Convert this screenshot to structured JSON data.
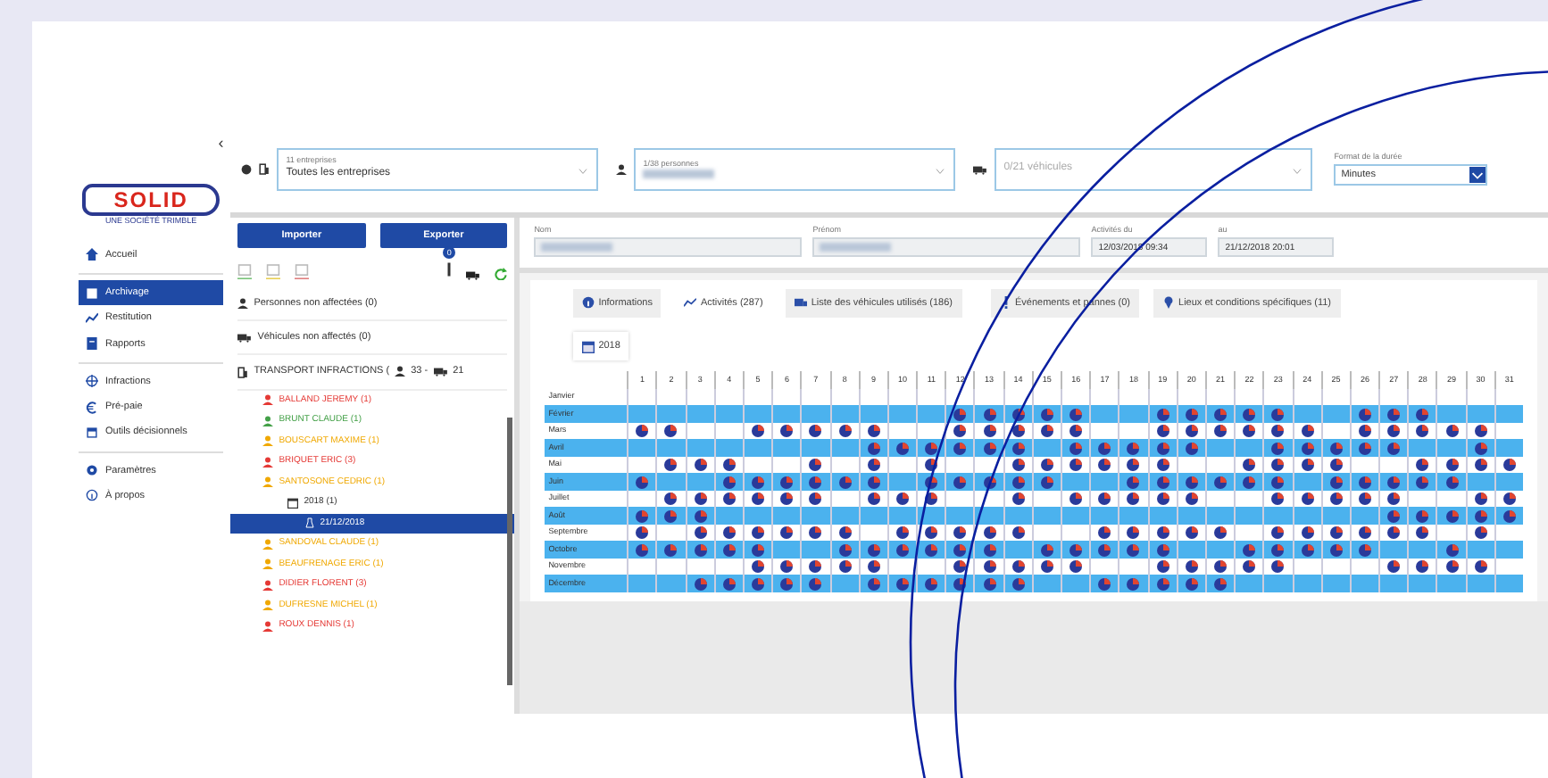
{
  "sidebar": {
    "collapse": "‹",
    "logo": "SOLID",
    "tagline": "UNE SOCIÉTÉ TRIMBLE",
    "groups": [
      [
        {
          "label": "Accueil",
          "selected": false
        }
      ],
      [
        {
          "label": "Archivage",
          "selected": true
        },
        {
          "label": "Restitution",
          "selected": false
        },
        {
          "label": "Rapports",
          "selected": false
        }
      ],
      [
        {
          "label": "Infractions",
          "selected": false
        },
        {
          "label": "Pré-paie",
          "selected": false
        },
        {
          "label": "Outils décisionnels",
          "selected": false
        }
      ],
      [
        {
          "label": "Paramètres",
          "selected": false
        },
        {
          "label": "À propos",
          "selected": false
        }
      ]
    ]
  },
  "filters": {
    "companies": {
      "label": "11 entreprises",
      "value": "Toutes les entreprises"
    },
    "persons": {
      "label": "1/38 personnes",
      "redacted": true
    },
    "vehicles": {
      "placeholder": "0/21 véhicules"
    },
    "duration": {
      "label": "Format de la durée",
      "value": "Minutes"
    }
  },
  "toolbar": {
    "buttons": [
      "Importer",
      "Exporter"
    ],
    "badge": "0"
  },
  "tree": [
    {
      "kind": "persons",
      "label": "Personnes non affectées (0)",
      "selected": false
    },
    {
      "kind": "vehicles",
      "label": "Véhicules non affectés (0)",
      "selected": false
    },
    {
      "kind": "company",
      "label": "TRANSPORT INFRACTIONS (",
      "persons_count": "33 -",
      "vehicles_count": "21",
      "selected": false,
      "children": [
        {
          "label": "BALLAND JEREMY (1)",
          "color": "#e53935",
          "selected": false
        },
        {
          "label": "BRUNT CLAUDE (1)",
          "color": "#43a047",
          "selected": false
        },
        {
          "label": "BOUSCART MAXIME (1)",
          "color": "#f0a800",
          "selected": false
        },
        {
          "label": "BRIQUET ERIC (3)",
          "color": "#e53935",
          "selected": false
        },
        {
          "label": "SANTOSONE CEDRIC (1)",
          "color": "#f0a800",
          "selected": false,
          "children": [
            {
              "label": "2018 (1)",
              "selected": false,
              "children": [
                {
                  "label": "21/12/2018",
                  "selected": true
                }
              ]
            }
          ]
        },
        {
          "label": "SANDOVAL CLAUDE (1)",
          "color": "#f0a800",
          "selected": false
        },
        {
          "label": "BEAUFRENAGE ERIC (1)",
          "color": "#f0a800",
          "selected": false
        },
        {
          "label": "DIDIER FLORENT (3)",
          "color": "#e53935",
          "selected": false
        },
        {
          "label": "DUFRESNE MICHEL (1)",
          "color": "#f0a800",
          "selected": false
        },
        {
          "label": "ROUX DENNIS (1)",
          "color": "#e53935",
          "selected": false
        }
      ]
    }
  ],
  "details": {
    "fields": [
      {
        "label": "Nom",
        "redacted": true
      },
      {
        "label": "Prénom",
        "redacted": true
      },
      {
        "label": "Activités du",
        "value": "12/03/2018 09:34"
      },
      {
        "label": "au",
        "value": "21/12/2018 20:01"
      }
    ]
  },
  "tabs": [
    {
      "label": "Informations",
      "selected": false
    },
    {
      "label": "Activités (287)",
      "selected": true
    },
    {
      "label": "Liste des véhicules utilisés (186)",
      "selected": false
    },
    {
      "label": "Événements et pannes (0)",
      "selected": false
    },
    {
      "label": "Lieux et conditions spécifiques (11)",
      "selected": false
    }
  ],
  "year_tabs": [
    {
      "label": "2018",
      "selected": true
    }
  ],
  "calendar": {
    "days": [
      "1",
      "2",
      "3",
      "4",
      "5",
      "6",
      "7",
      "8",
      "9",
      "10",
      "11",
      "12",
      "13",
      "14",
      "15",
      "16",
      "17",
      "18",
      "19",
      "20",
      "21",
      "22",
      "23",
      "24",
      "25",
      "26",
      "27",
      "28",
      "29",
      "30",
      "31"
    ],
    "months": [
      {
        "name": "Janvier",
        "activity": [
          false,
          false,
          false,
          false,
          false,
          false,
          false,
          false,
          false,
          false,
          false,
          false,
          false,
          false,
          false,
          false,
          false,
          false,
          false,
          false,
          false,
          false,
          false,
          false,
          false,
          false,
          false,
          false,
          false,
          false,
          false
        ]
      },
      {
        "name": "Février",
        "activity": [
          false,
          false,
          false,
          false,
          false,
          false,
          false,
          false,
          false,
          false,
          false,
          true,
          true,
          true,
          true,
          true,
          false,
          false,
          true,
          true,
          true,
          true,
          true,
          false,
          false,
          true,
          true,
          true,
          false,
          false,
          false
        ]
      },
      {
        "name": "Mars",
        "activity": [
          true,
          true,
          false,
          false,
          true,
          true,
          true,
          true,
          true,
          false,
          false,
          true,
          true,
          true,
          true,
          true,
          false,
          false,
          true,
          true,
          true,
          true,
          true,
          true,
          false,
          true,
          true,
          true,
          true,
          true,
          false
        ]
      },
      {
        "name": "Avril",
        "activity": [
          false,
          false,
          false,
          false,
          false,
          false,
          false,
          false,
          true,
          true,
          true,
          true,
          true,
          true,
          false,
          true,
          true,
          true,
          true,
          true,
          false,
          false,
          true,
          true,
          true,
          true,
          true,
          false,
          false,
          true,
          false
        ]
      },
      {
        "name": "Mai",
        "activity": [
          false,
          true,
          true,
          true,
          false,
          false,
          true,
          false,
          true,
          false,
          true,
          false,
          false,
          true,
          true,
          true,
          true,
          true,
          true,
          false,
          false,
          true,
          true,
          true,
          true,
          false,
          false,
          true,
          true,
          true,
          true
        ]
      },
      {
        "name": "Juin",
        "activity": [
          true,
          false,
          false,
          true,
          true,
          true,
          true,
          true,
          true,
          false,
          true,
          true,
          true,
          true,
          true,
          false,
          false,
          true,
          true,
          true,
          true,
          true,
          true,
          false,
          true,
          true,
          true,
          true,
          true,
          false,
          false
        ]
      },
      {
        "name": "Juillet",
        "activity": [
          false,
          true,
          true,
          true,
          true,
          true,
          true,
          false,
          true,
          true,
          true,
          false,
          false,
          true,
          false,
          true,
          true,
          true,
          true,
          true,
          false,
          false,
          true,
          true,
          true,
          true,
          true,
          false,
          false,
          true,
          true
        ]
      },
      {
        "name": "Août",
        "activity": [
          true,
          true,
          true,
          false,
          false,
          false,
          false,
          false,
          false,
          false,
          false,
          false,
          false,
          false,
          false,
          false,
          false,
          false,
          false,
          false,
          false,
          false,
          false,
          false,
          false,
          false,
          true,
          true,
          true,
          true,
          true
        ]
      },
      {
        "name": "Septembre",
        "activity": [
          true,
          false,
          true,
          true,
          true,
          true,
          true,
          true,
          false,
          true,
          true,
          true,
          true,
          true,
          false,
          false,
          true,
          true,
          true,
          true,
          true,
          false,
          true,
          true,
          true,
          true,
          true,
          true,
          false,
          true,
          false
        ]
      },
      {
        "name": "Octobre",
        "activity": [
          true,
          true,
          true,
          true,
          true,
          false,
          false,
          true,
          true,
          true,
          true,
          true,
          true,
          false,
          true,
          true,
          true,
          true,
          true,
          false,
          false,
          true,
          true,
          true,
          true,
          true,
          false,
          false,
          true,
          false,
          false
        ]
      },
      {
        "name": "Novembre",
        "activity": [
          false,
          false,
          false,
          false,
          true,
          true,
          true,
          true,
          true,
          false,
          false,
          true,
          true,
          true,
          true,
          true,
          false,
          false,
          true,
          true,
          true,
          true,
          true,
          false,
          false,
          false,
          true,
          true,
          true,
          true,
          false
        ]
      },
      {
        "name": "Décembre",
        "activity": [
          false,
          false,
          true,
          true,
          true,
          true,
          true,
          false,
          true,
          true,
          true,
          true,
          true,
          true,
          false,
          false,
          true,
          true,
          true,
          true,
          true,
          false,
          false,
          false,
          false,
          false,
          false,
          false,
          false,
          false,
          false
        ]
      }
    ]
  }
}
